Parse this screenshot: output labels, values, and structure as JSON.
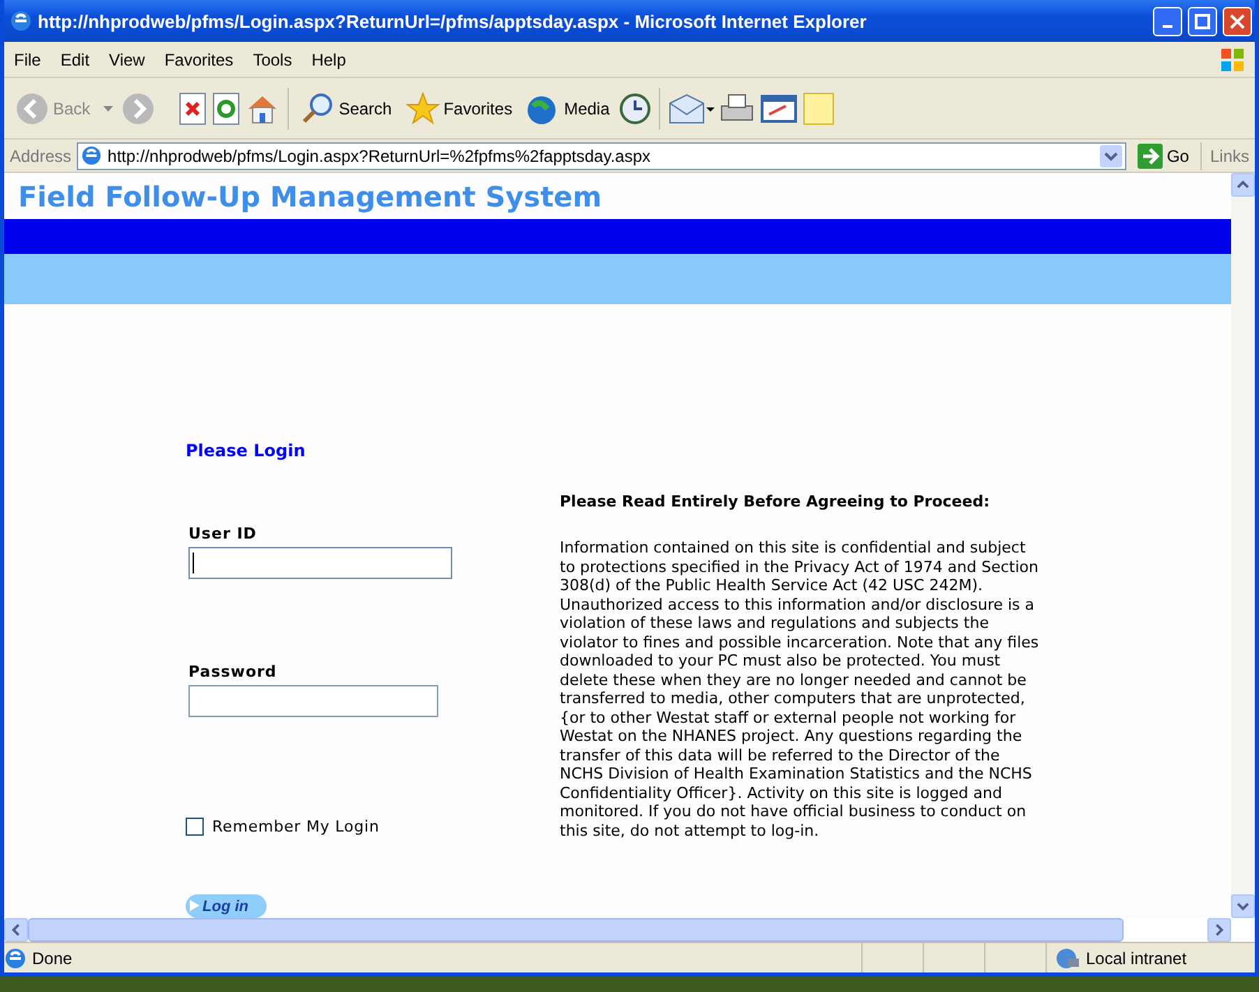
{
  "window": {
    "title": "http://nhprodweb/pfms/Login.aspx?ReturnUrl=/pfms/apptsday.aspx - Microsoft Internet Explorer"
  },
  "menu": [
    "File",
    "Edit",
    "View",
    "Favorites",
    "Tools",
    "Help"
  ],
  "toolbar": {
    "back": "Back",
    "search": "Search",
    "favorites": "Favorites",
    "media": "Media"
  },
  "address": {
    "label": "Address",
    "url": "http://nhprodweb/pfms/Login.aspx?ReturnUrl=%2fpfms%2fapptsday.aspx",
    "go": "Go",
    "links": "Links"
  },
  "page": {
    "title": "Field Follow-Up Management System",
    "login": {
      "heading": "Please Login",
      "fields": [
        {
          "label": "User ID",
          "focused": true
        },
        {
          "label": "Password",
          "focused": false
        }
      ],
      "remember": {
        "label": "Remember My Login",
        "checked": false
      },
      "button": "Log in"
    },
    "notice": {
      "heading": "Please Read Entirely Before Agreeing to Proceed:",
      "body": "Information contained on this site is confidential and subject to protections specified in the Privacy Act of 1974 and Section 308(d) of the Public Health Service Act (42 USC 242M). Unauthorized access to this information and/or disclosure is a violation of these laws and regulations and subjects the violator to fines and possible incarceration. Note that any files downloaded to your PC must also be protected. You must delete these when they are no longer needed and cannot be transferred to media, other computers that are unprotected, {or to other Westat staff or external people not working for Westat on the NHANES project. Any questions regarding the transfer of this data will be referred to the Director of the NCHS Division of Health Examination Statistics and the NCHS Confidentiality Officer}. Activity on this site is logged and monitored. If you do not have official business to conduct on this site, do not attempt to log-in."
    }
  },
  "status": {
    "text": "Done",
    "zone": "Local intranet"
  }
}
